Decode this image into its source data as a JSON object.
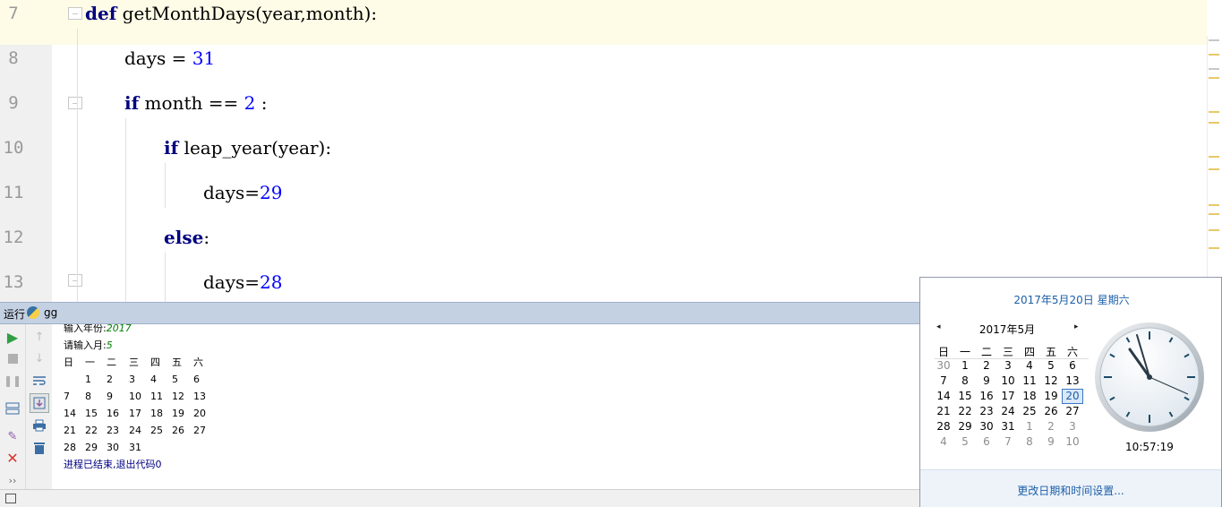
{
  "editor": {
    "lines": [
      {
        "no": "7"
      },
      {
        "no": "8"
      },
      {
        "no": "9"
      },
      {
        "no": "10"
      },
      {
        "no": "11"
      },
      {
        "no": "12"
      },
      {
        "no": "13"
      }
    ],
    "tokens": {
      "l7_kw": "def",
      "l7_rest": " getMonthDays(year,month):",
      "l8_a": "days = ",
      "l8_num": "31",
      "l9_kw": "if",
      "l9_a": " month == ",
      "l9_num": "2",
      "l9_b": " :",
      "l10_kw": "if",
      "l10_rest": " leap_year(year):",
      "l11_a": "days=",
      "l11_num": "29",
      "l12_kw": "else",
      "l12_rest": ":",
      "l13_a": "days=",
      "l13_num": "28"
    },
    "colors": {
      "keyword": "#000080",
      "number": "#0000ff",
      "current_line": "#fefbe6"
    }
  },
  "run": {
    "title": "运行",
    "config": "gg",
    "toolbar_icons": [
      "run-icon",
      "stop-icon",
      "pause-icon",
      "layout-icon",
      "pin-icon",
      "close-icon",
      "more-icon",
      "up-arrow-icon",
      "down-arrow-icon",
      "soft-wrap-icon",
      "scroll-to-end-icon",
      "print-icon",
      "trash-icon"
    ],
    "console": {
      "prompt_year": "输入年份:",
      "input_year": "2017",
      "prompt_month": "请输入月:",
      "input_month": "5",
      "weekdays": [
        "日",
        "一",
        "二",
        "三",
        "四",
        "五",
        "六"
      ],
      "weeks": [
        [
          "",
          "1",
          "2",
          "3",
          "4",
          "5",
          "6"
        ],
        [
          "7",
          "8",
          "9",
          "10",
          "11",
          "12",
          "13"
        ],
        [
          "14",
          "15",
          "16",
          "17",
          "18",
          "19",
          "20"
        ],
        [
          "21",
          "22",
          "23",
          "24",
          "25",
          "26",
          "27"
        ],
        [
          "28",
          "29",
          "30",
          "31",
          "",
          "",
          ""
        ]
      ],
      "exit_message": "进程已结束,退出代码0"
    }
  },
  "popup": {
    "full_date": "2017年5月20日 星期六",
    "month_title": "2017年5月",
    "prev_icon": "◂",
    "next_icon": "▸",
    "weekdays": [
      "日",
      "一",
      "二",
      "三",
      "四",
      "五",
      "六"
    ],
    "weeks": [
      [
        "30",
        "1",
        "2",
        "3",
        "4",
        "5",
        "6"
      ],
      [
        "7",
        "8",
        "9",
        "10",
        "11",
        "12",
        "13"
      ],
      [
        "14",
        "15",
        "16",
        "17",
        "18",
        "19",
        "20"
      ],
      [
        "21",
        "22",
        "23",
        "24",
        "25",
        "26",
        "27"
      ],
      [
        "28",
        "29",
        "30",
        "31",
        "1",
        "2",
        "3"
      ],
      [
        "4",
        "5",
        "6",
        "7",
        "8",
        "9",
        "10"
      ]
    ],
    "time": "10:57:19",
    "settings_link": "更改日期和时间设置...",
    "accent": "#1c5fa8"
  }
}
